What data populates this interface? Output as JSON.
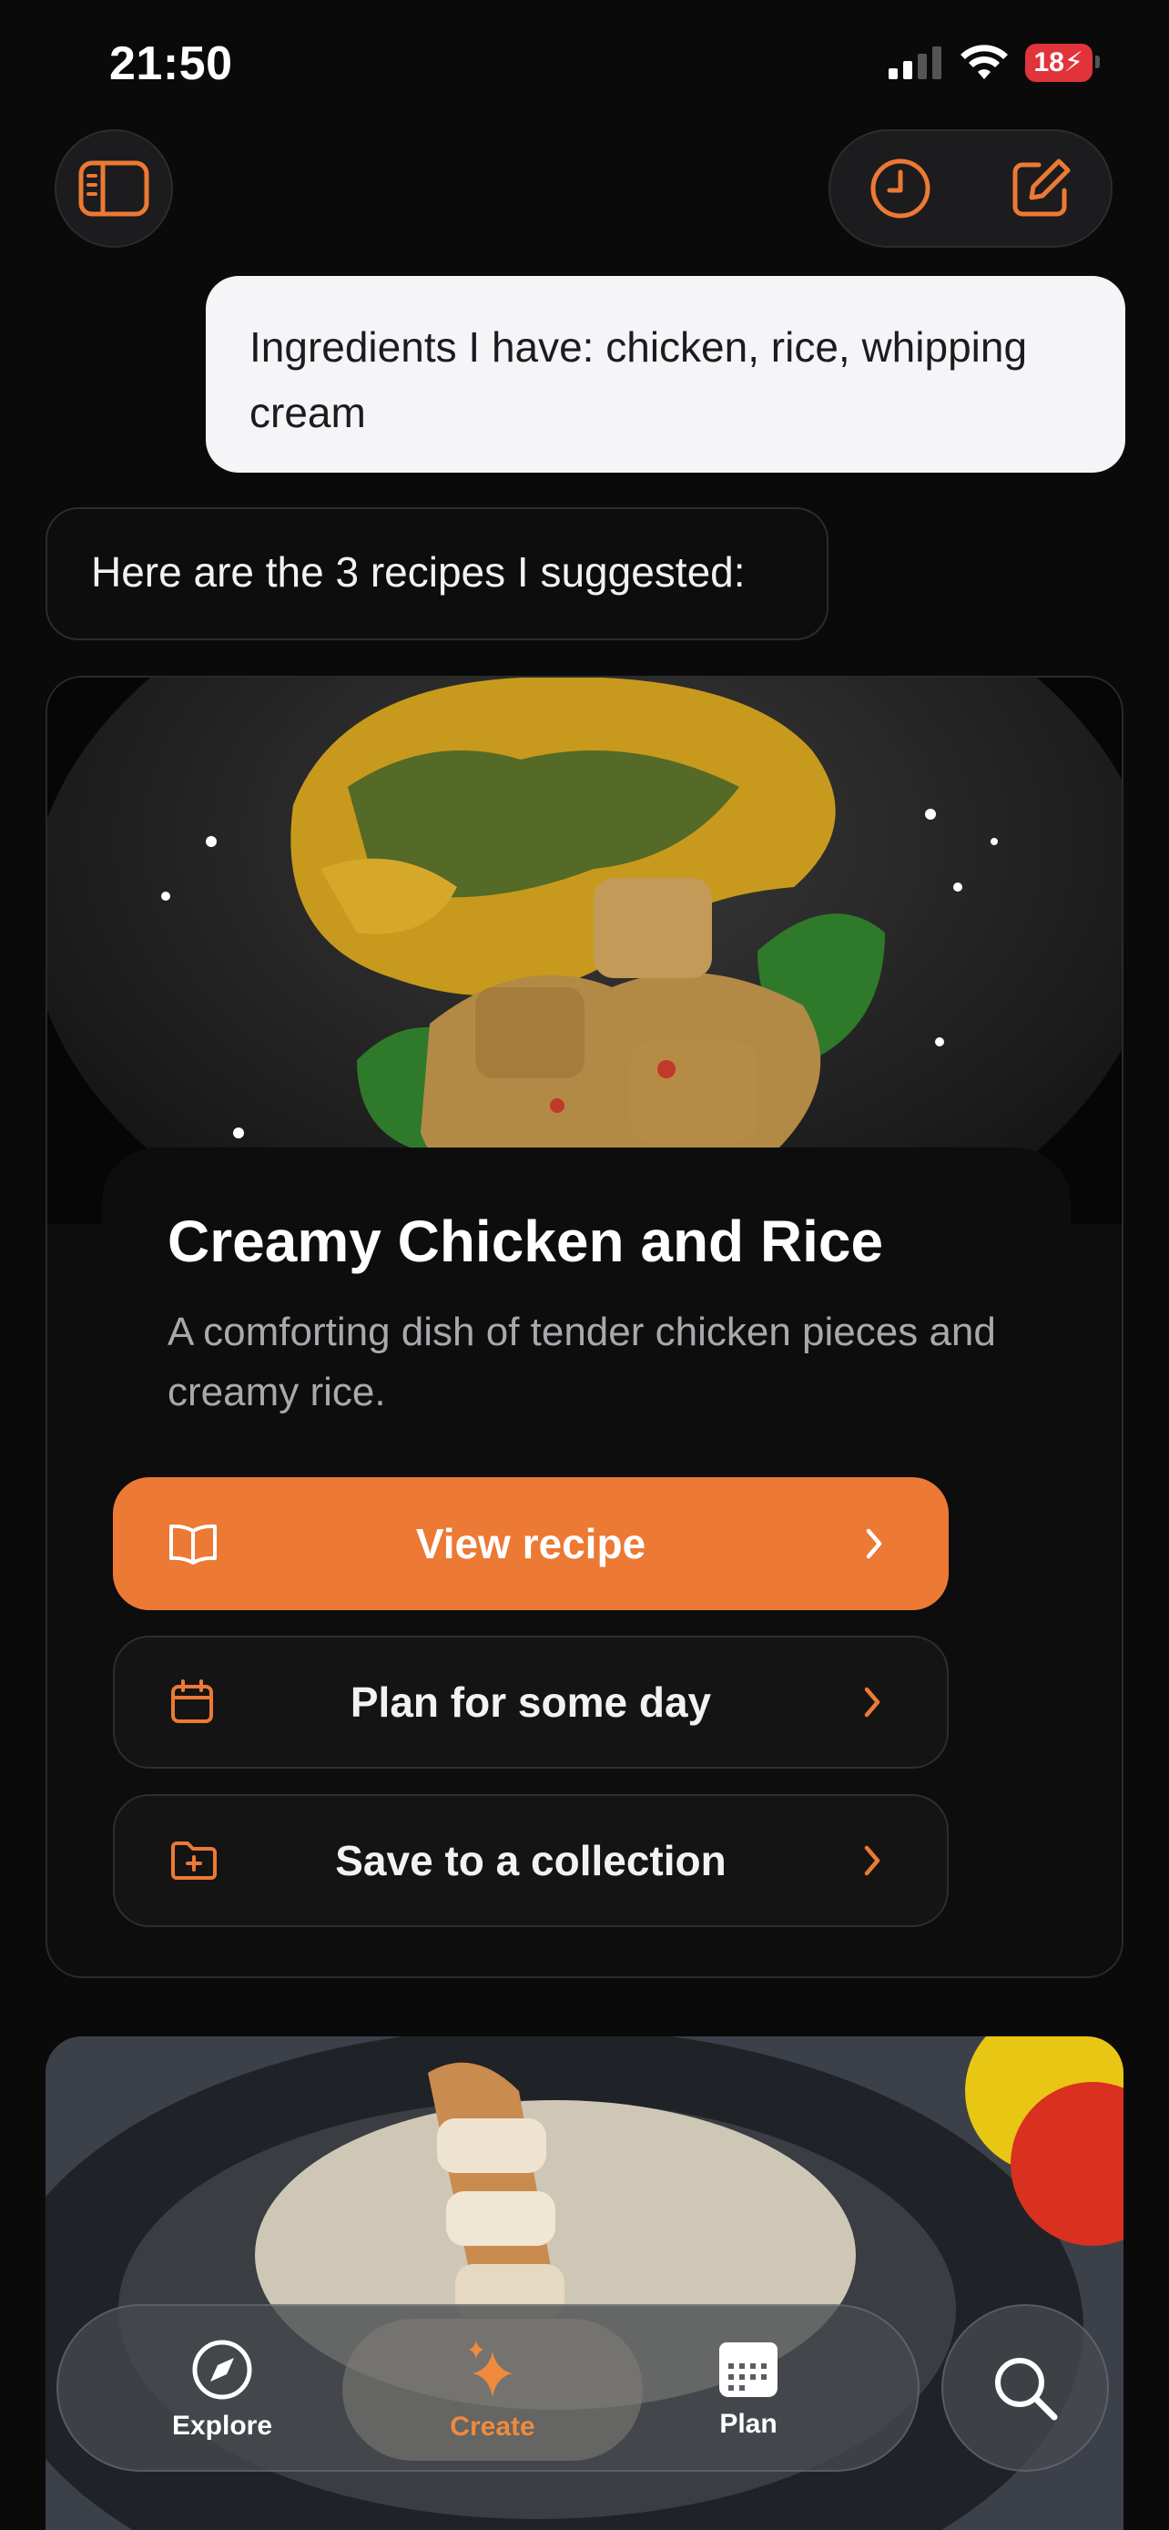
{
  "status_bar": {
    "time": "21:50",
    "battery": "18"
  },
  "chat": {
    "user_message": "Ingredients I have: chicken, rice, whipping cream",
    "assistant_message": "Here are the 3 recipes I suggested:"
  },
  "recipes": [
    {
      "title": "Creamy Chicken and Rice",
      "description": "A comforting dish of tender chicken pieces and creamy rice.",
      "actions": {
        "view": "View recipe",
        "plan": "Plan for some day",
        "save": "Save to a collection"
      }
    }
  ],
  "tabbar": {
    "explore": "Explore",
    "create": "Create",
    "plan": "Plan"
  },
  "colors": {
    "accent": "#ec7934",
    "background": "#0a0a0a"
  },
  "icons": [
    "sidebar-icon",
    "history-icon",
    "compose-icon",
    "book-icon",
    "calendar-icon",
    "folder-plus-icon",
    "chevron-right-icon",
    "compass-icon",
    "sparkles-icon",
    "search-icon"
  ]
}
